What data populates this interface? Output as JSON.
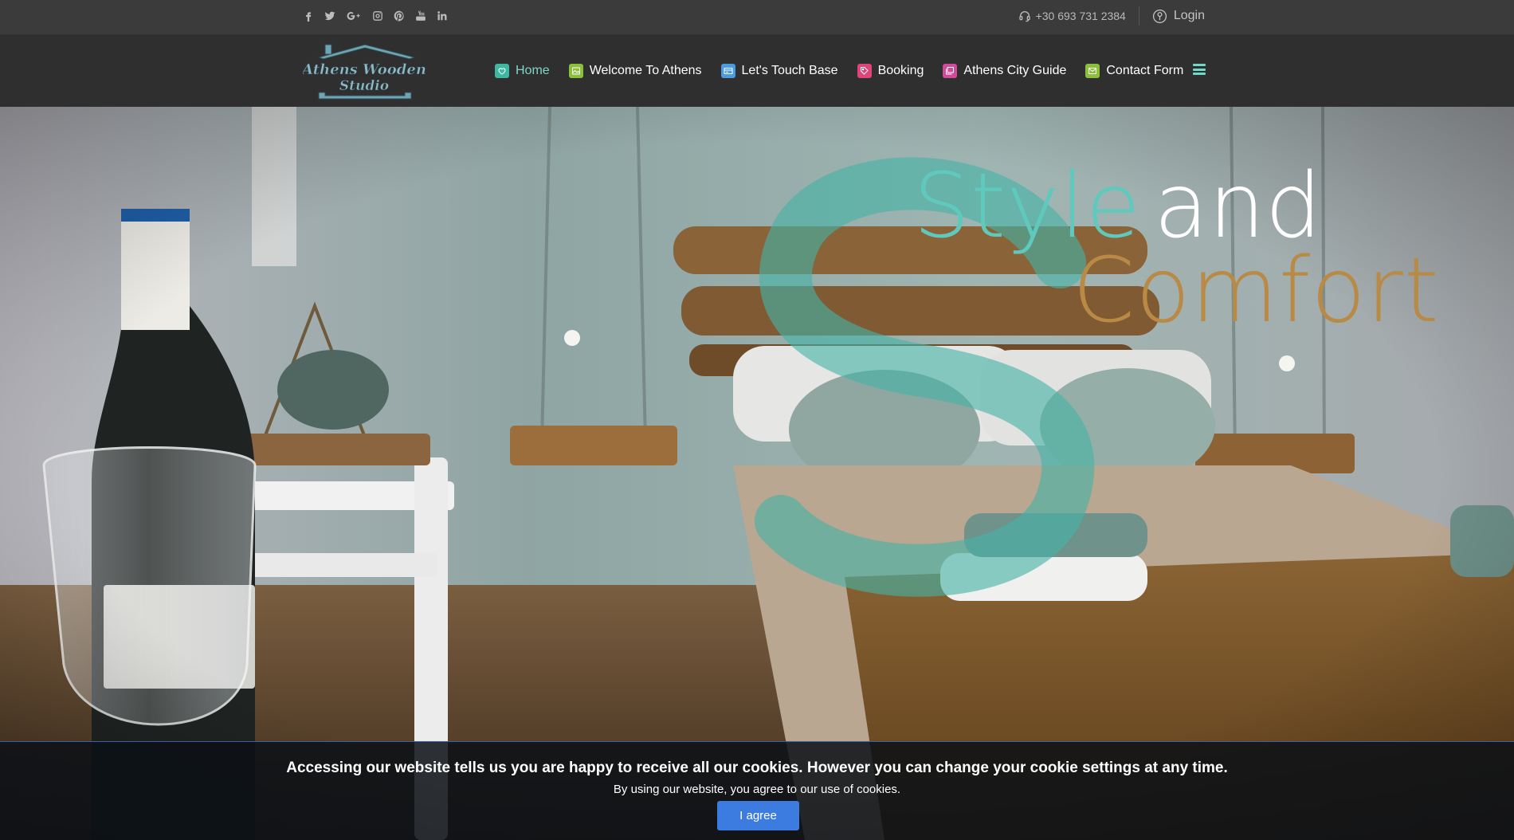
{
  "topbar": {
    "social": [
      {
        "icon": "facebook-icon"
      },
      {
        "icon": "twitter-icon"
      },
      {
        "icon": "google-plus-icon"
      },
      {
        "icon": "instagram-icon"
      },
      {
        "icon": "pinterest-icon"
      },
      {
        "icon": "youtube-icon"
      },
      {
        "icon": "linkedin-icon"
      }
    ],
    "phone": "+30 693 731 2384",
    "login_label": "Login"
  },
  "logo": {
    "line1": "Athens Wooden",
    "line2": "Studio"
  },
  "nav": {
    "items": [
      {
        "label": "Home",
        "icon": "heart-icon",
        "color": "#3fb8a2",
        "active": true
      },
      {
        "label": "Welcome To Athens",
        "icon": "image-icon",
        "color": "#8bbf3c"
      },
      {
        "label": "Let's Touch Base",
        "icon": "card-icon",
        "color": "#4a9be0"
      },
      {
        "label": "Booking",
        "icon": "tag-icon",
        "color": "#e0457a"
      },
      {
        "label": "Athens City Guide",
        "icon": "photos-icon",
        "color": "#d14b9c"
      },
      {
        "label": "Contact Form",
        "icon": "envelope-icon",
        "color": "#8bbf3c"
      }
    ],
    "menu_icon": "hamburger-icon",
    "accent": "#6fd8c8"
  },
  "hero": {
    "word1": "Style",
    "word2": "and",
    "word3": "Comfort"
  },
  "cookie": {
    "main": "Accessing our website tells us you are happy to receive all our cookies. However you can change your cookie settings at any time.",
    "sub": "By using our website, you agree to our use of cookies.",
    "button": "I agree",
    "button_color": "#3c7be0"
  }
}
